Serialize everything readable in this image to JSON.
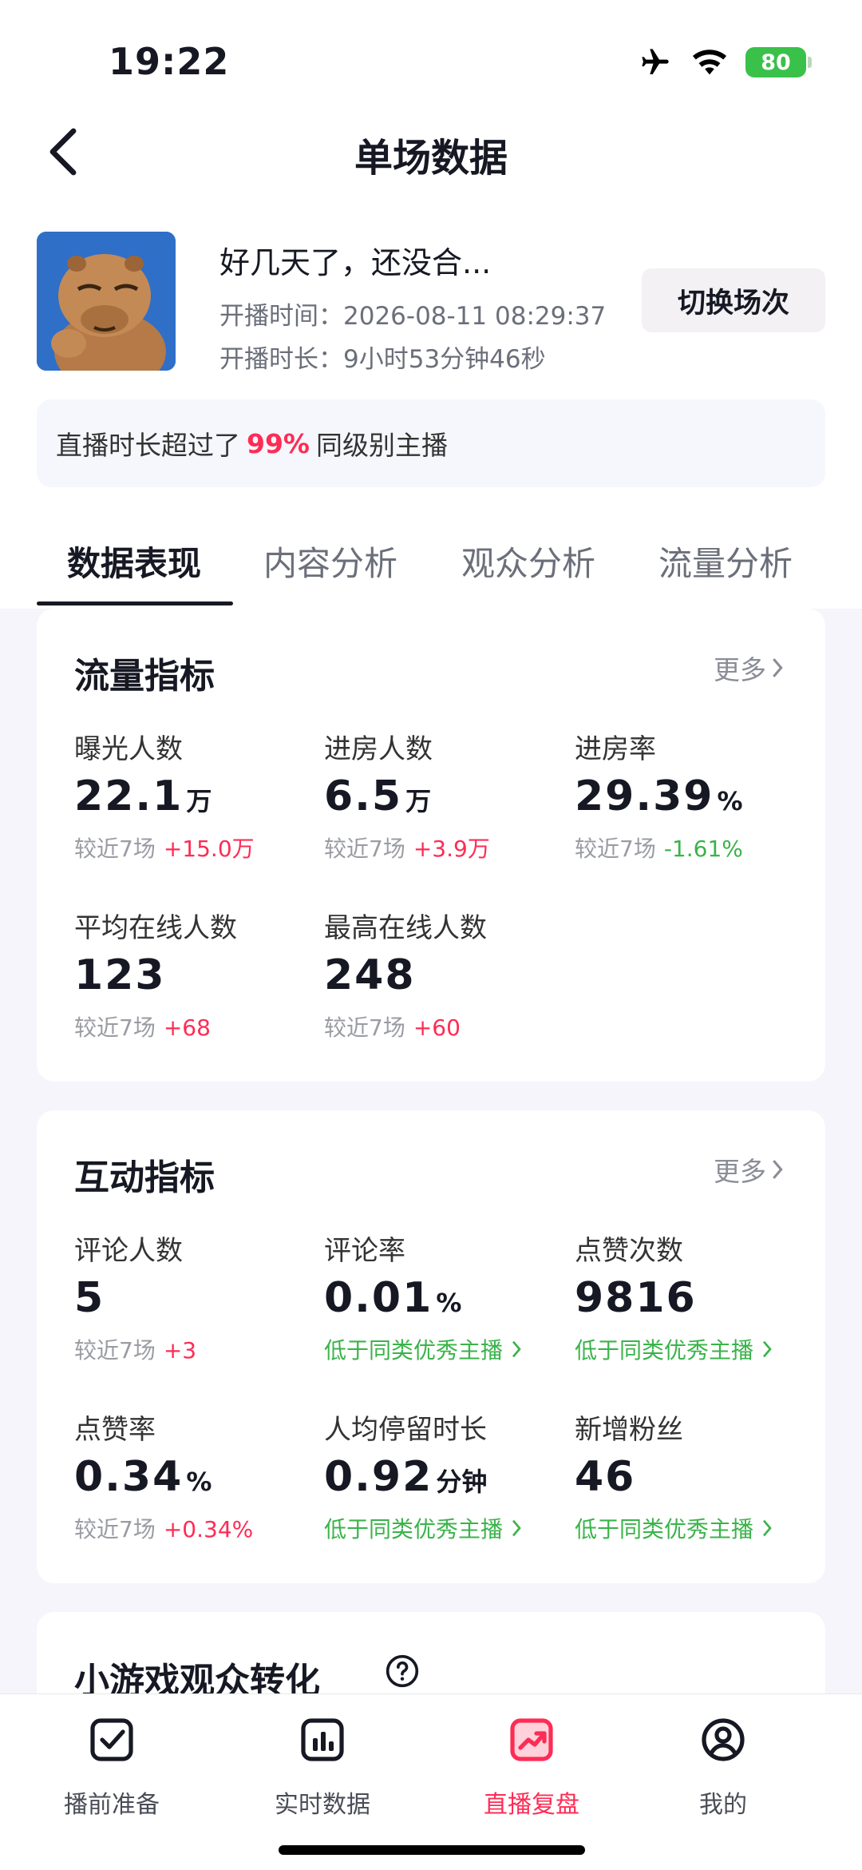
{
  "status_bar": {
    "time": "19:22",
    "battery": "80"
  },
  "nav": {
    "title": "单场数据"
  },
  "stream": {
    "title": "好几天了，还没合...",
    "start_time": "开播时间：2026-08-11 08:29:37",
    "duration": "开播时长：9小时53分钟46秒",
    "switch_label": "切换场次"
  },
  "banner": {
    "prefix": "直播时长超过了",
    "percent": "99%",
    "suffix": "同级别主播"
  },
  "tabs": [
    "数据表现",
    "内容分析",
    "观众分析",
    "流量分析"
  ],
  "traffic": {
    "title": "流量指标",
    "more": "更多",
    "metrics": [
      {
        "label": "曝光人数",
        "value": "22.1",
        "unit": "万",
        "compare": "较近7场",
        "delta": "+15.0万"
      },
      {
        "label": "进房人数",
        "value": "6.5",
        "unit": "万",
        "compare": "较近7场",
        "delta": "+3.9万"
      },
      {
        "label": "进房率",
        "value": "29.39",
        "unit": "%",
        "compare": "较近7场",
        "delta": "-1.61%"
      },
      {
        "label": "平均在线人数",
        "value": "123",
        "unit": "",
        "compare": "较近7场",
        "delta": "+68"
      },
      {
        "label": "最高在线人数",
        "value": "248",
        "unit": "",
        "compare": "较近7场",
        "delta": "+60"
      }
    ]
  },
  "interaction": {
    "title": "互动指标",
    "more": "更多",
    "metrics": [
      {
        "label": "评论人数",
        "value": "5",
        "unit": "",
        "compare": "较近7场",
        "delta": "+3"
      },
      {
        "label": "评论率",
        "value": "0.01",
        "unit": "%",
        "note": "低于同类优秀主播"
      },
      {
        "label": "点赞次数",
        "value": "9816",
        "unit": "",
        "note": "低于同类优秀主播"
      },
      {
        "label": "点赞率",
        "value": "0.34",
        "unit": "%",
        "compare": "较近7场",
        "delta": "+0.34%"
      },
      {
        "label": "人均停留时长",
        "value": "0.92",
        "unit": "分钟",
        "note": "低于同类优秀主播"
      },
      {
        "label": "新增粉丝",
        "value": "46",
        "unit": "",
        "note": "低于同类优秀主播"
      }
    ]
  },
  "mini_game": {
    "title": "小游戏观众转化"
  },
  "bottom_nav": [
    {
      "label": "播前准备",
      "icon": "checkbox-icon"
    },
    {
      "label": "实时数据",
      "icon": "bar-chart-icon"
    },
    {
      "label": "直播复盘",
      "icon": "trend-chart-icon"
    },
    {
      "label": "我的",
      "icon": "user-icon"
    }
  ],
  "colors": {
    "accent": "#fe2c55",
    "positive": "#fe2c55",
    "negative": "#3ab34a"
  }
}
